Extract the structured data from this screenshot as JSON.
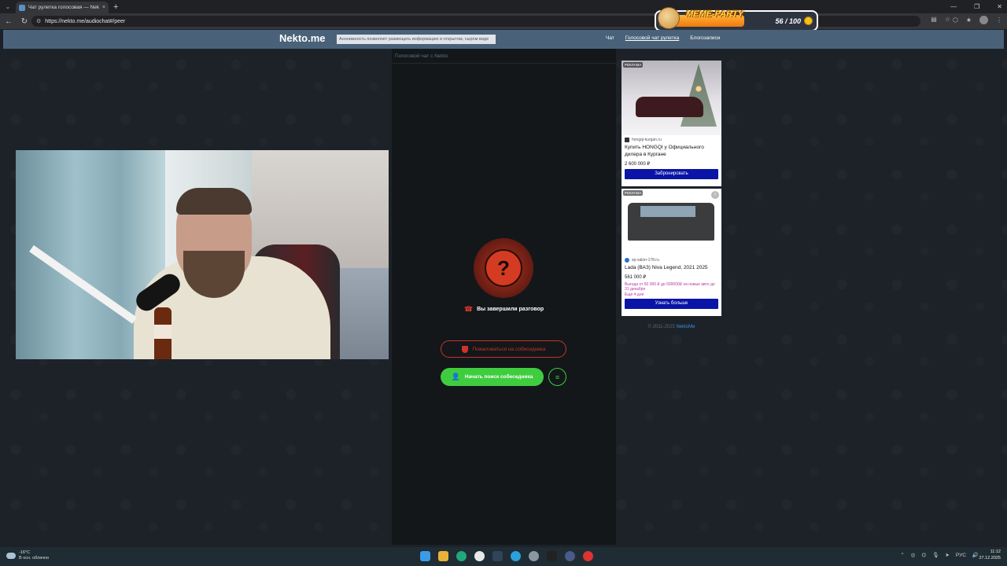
{
  "browser": {
    "tab_title": "Чат рулетка голосовая — Nekto.me",
    "tab_close": "×",
    "new_tab": "+",
    "url": "https://nekto.me/audiochat#/peer"
  },
  "meme_party": {
    "title": "MEME-PARTY",
    "count": "56 / 100"
  },
  "site": {
    "logo": "Nekto.me",
    "notice": "Анонимность позволяет размещать информацию в открытом, сыром виде",
    "nav": [
      "Чат",
      "Голосовой чат рулетка",
      "Блогозаписи"
    ]
  },
  "chat": {
    "header": "Голосовой чат с Nekto",
    "status_symbol": "?",
    "ended_text": "Вы завершили разговор",
    "report_label": "Пожаловаться на собеседника",
    "search_label": "Начать поиск собеседника"
  },
  "ads": [
    {
      "label": "РЕКЛАМА",
      "domain": "hongqi-kurgan.ru",
      "title": "Купить HONGQI у Официального дилера в Кургане",
      "price": "2 600 000 ₽",
      "button": "Забронировать"
    },
    {
      "label": "РЕКЛАМА",
      "info": "i",
      "domain": "sp-salon-178.ru",
      "title": "Lada (ВАЗ) Niva Legend, 2021 2025",
      "price": "561 000 ₽",
      "promo": "Выгода от 50 000 ₽ до 500000₽ на новые авто до 31 декабря",
      "promo2": "Ещё 4 дня",
      "button": "Узнать больше"
    }
  ],
  "footer": {
    "copyright": "© 2011-2025",
    "link": "NektoMe"
  },
  "taskbar": {
    "temperature": "-16°C",
    "weather": "В осн. облачно",
    "language": "РУС",
    "time": "11:12",
    "date": "27.12.2025"
  },
  "colors": {
    "header": "#4a6279",
    "green": "#3fcd3f",
    "red": "#c8322a",
    "ad_button": "#0a14a6"
  }
}
